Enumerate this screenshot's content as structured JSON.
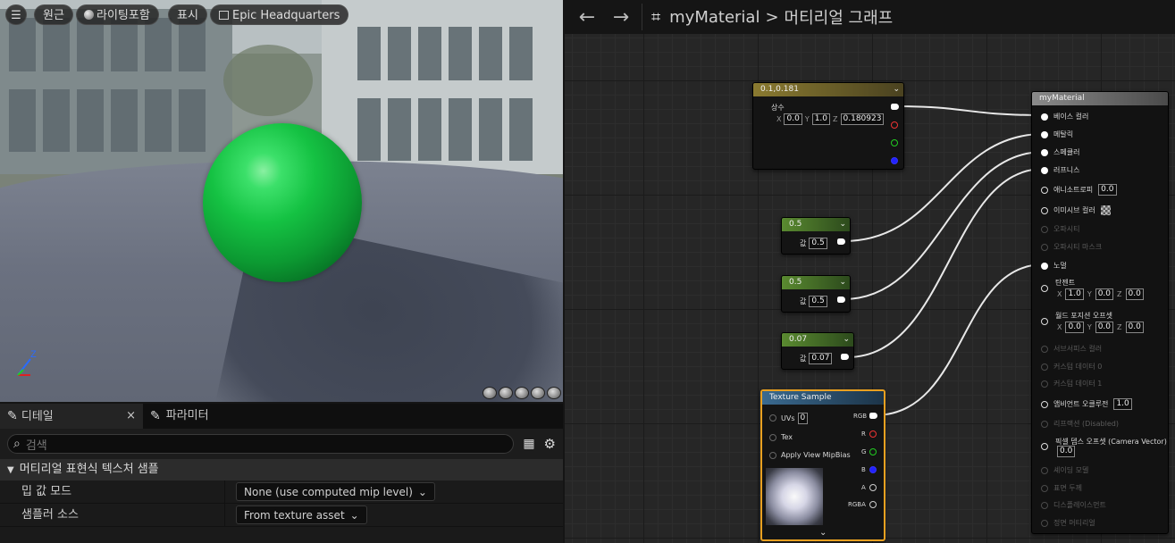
{
  "viewport": {
    "menu_icon": "hamburger-icon",
    "buttons": {
      "perspective": "원근",
      "lighting": "라이팅포함",
      "show": "표시",
      "level": "Epic Headquarters"
    },
    "axis": {
      "z": "Z"
    }
  },
  "details": {
    "tab_details": "디테일",
    "tab_close": "×",
    "tab_params": "파라미터",
    "search_placeholder": "검색",
    "section_title": "머티리얼 표현식 텍스처 샘플",
    "rows": [
      {
        "label": "밉 값 모드",
        "value": "None (use computed mip level)"
      },
      {
        "label": "샘플러 소스",
        "value": "From texture asset"
      }
    ]
  },
  "graph": {
    "back": "🡠",
    "forward": "🡢",
    "crumb_material": "myMaterial",
    "crumb_sep": ">",
    "crumb_graph": "머티리얼 그래프",
    "const3": {
      "title": "0.1,0.181",
      "label": "상수",
      "x_label": "X",
      "x": "0.0",
      "y_label": "Y",
      "y": "1.0",
      "z_label": "Z",
      "z": "0.180923"
    },
    "const_a": {
      "title": "0.5",
      "pin_label": "값",
      "value": "0.5"
    },
    "const_b": {
      "title": "0.5",
      "pin_label": "값",
      "value": "0.5"
    },
    "const_c": {
      "title": "0.07",
      "pin_label": "값",
      "value": "0.07"
    },
    "texture": {
      "title": "Texture Sample",
      "uvs": "UVs",
      "uvs_val": "0",
      "tex": "Tex",
      "mip": "Apply View MipBias",
      "outs": [
        "RGB",
        "R",
        "G",
        "B",
        "A",
        "RGBA"
      ]
    },
    "material": {
      "title": "myMaterial",
      "base_color": "베이스 컬러",
      "metallic": "메탈릭",
      "specular": "스페큘러",
      "roughness": "러프니스",
      "anisotropy": "애니소트로피",
      "anisotropy_val": "0.0",
      "emissive": "이미시브 컬러",
      "opacity": "오파시티",
      "opacity_mask": "오파시티 마스크",
      "normal": "노멀",
      "tangent": "탄젠트",
      "tangent_x": "1.0",
      "tangent_y": "0.0",
      "tangent_z": "0.0",
      "wpo": "월드 포지션 오프셋",
      "wpo_x": "0.0",
      "wpo_y": "0.0",
      "wpo_z": "0.0",
      "subsurface": "서브서피스 컬러",
      "custom0": "커스텀 데이터 0",
      "custom1": "커스텀 데이터 1",
      "ao": "앰비언트 오클루전",
      "ao_val": "1.0",
      "refraction": "리프랙션 (Disabled)",
      "pdo": "픽셀 뎁스 오프셋 (Camera Vector)",
      "pdo_val": "0.0",
      "shading": "셰이딩 모델",
      "surface": "표면 두께",
      "displacement": "디스플레이스먼트",
      "front": "정면 머티리얼",
      "axis_x": "X",
      "axis_y": "Y",
      "axis_z": "Z"
    }
  },
  "colors": {
    "const3_head": "#7a6a2a",
    "const_head": "#4a7a2a",
    "texture_head": "#2a5a7a",
    "material_head": "#5a5a5a",
    "texture_border": "#e8a020"
  }
}
